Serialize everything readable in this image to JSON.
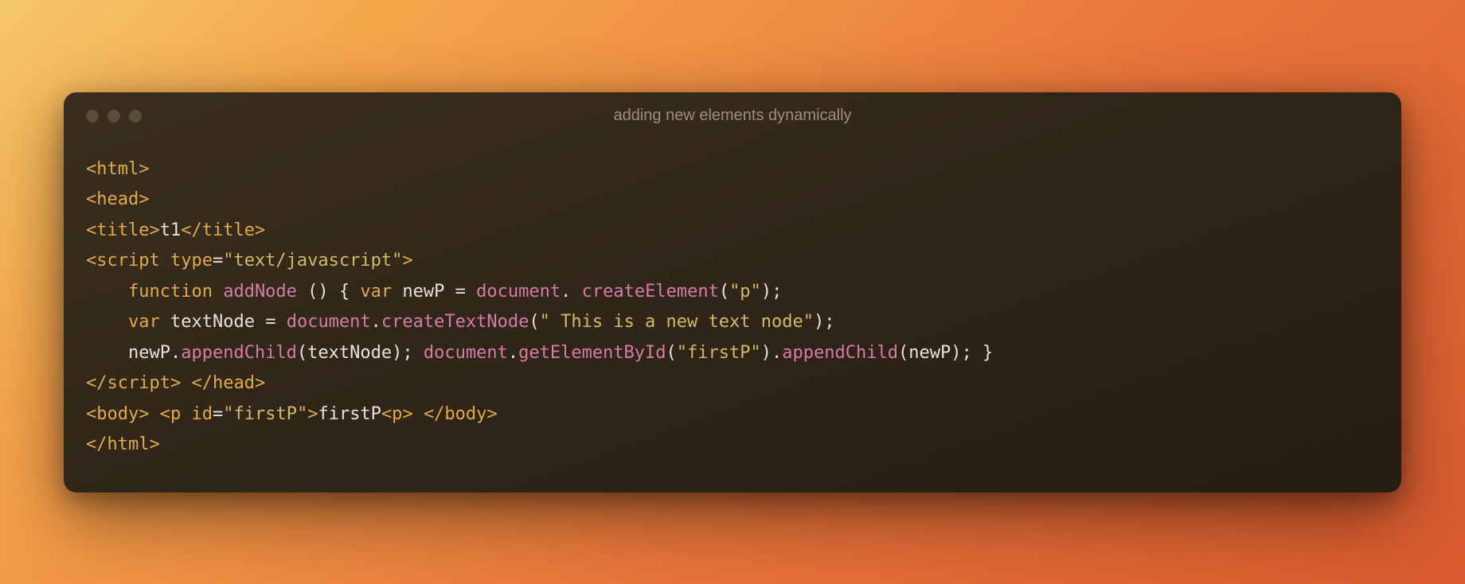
{
  "window": {
    "title": "adding new elements dynamically"
  },
  "code": {
    "l1": {
      "t_html_open": "<html>"
    },
    "l2": {
      "t_head_open": "<head>"
    },
    "l3": {
      "t_title_open": "<title>",
      "title_text": "t1",
      "t_title_close": "</title>"
    },
    "l4": {
      "t_script_open": "<script",
      "sp1": " ",
      "attr_type": "type",
      "eq": "=",
      "str_js": "\"text/javascript\"",
      "gt": ">"
    },
    "l5": {
      "indent": "    ",
      "kw_function": "function",
      "sp1": " ",
      "fn_addNode": "addNode",
      "sp2": " ",
      "paren_open": "(",
      "paren_close": ")",
      "sp3": " ",
      "brace_open": "{",
      "sp4": " ",
      "kw_var": "var",
      "sp5": " ",
      "id_newP": "newP",
      "sp6": " ",
      "eq": "=",
      "sp7": " ",
      "obj_document": "document",
      "dot": ".",
      "sp8": " ",
      "fn_createElement": "createElement",
      "paren_open2": "(",
      "str_p": "\"p\"",
      "paren_close2": ")",
      "semi": ";"
    },
    "l6": {
      "indent": "    ",
      "kw_var": "var",
      "sp1": " ",
      "id_textNode": "textNode",
      "sp2": " ",
      "eq": "=",
      "sp3": " ",
      "obj_document": "document",
      "dot": ".",
      "fn_createTextNode": "createTextNode",
      "paren_open": "(",
      "str_text": "\" This is a new text node\"",
      "paren_close": ")",
      "semi": ";"
    },
    "l7": {
      "indent": "    ",
      "id_newP": "newP",
      "dot1": ".",
      "fn_appendChild1": "appendChild",
      "paren_open1": "(",
      "id_textNode": "textNode",
      "paren_close1": ")",
      "semi1": ";",
      "sp1": " ",
      "obj_document": "document",
      "dot2": ".",
      "fn_getElementById": "getElementById",
      "paren_open2": "(",
      "str_firstP": "\"firstP\"",
      "paren_close2": ")",
      "dot3": ".",
      "fn_appendChild2": "appendChild",
      "paren_open3": "(",
      "id_newP2": "newP",
      "paren_close3": ")",
      "semi2": ";",
      "sp2": " ",
      "brace_close": "}"
    },
    "l8": {
      "t_script_close": "</script>",
      "sp": " ",
      "t_head_close": "</head>"
    },
    "l9": {
      "t_body_open": "<body>",
      "sp1": " ",
      "t_p_open": "<p",
      "sp2": " ",
      "attr_id": "id",
      "eq": "=",
      "str_firstP": "\"firstP\"",
      "gt": ">",
      "text_firstP": "firstP",
      "t_p2": "<p>",
      "sp3": " ",
      "t_body_close": "</body>"
    },
    "l10": {
      "t_html_close": "</html>"
    }
  }
}
